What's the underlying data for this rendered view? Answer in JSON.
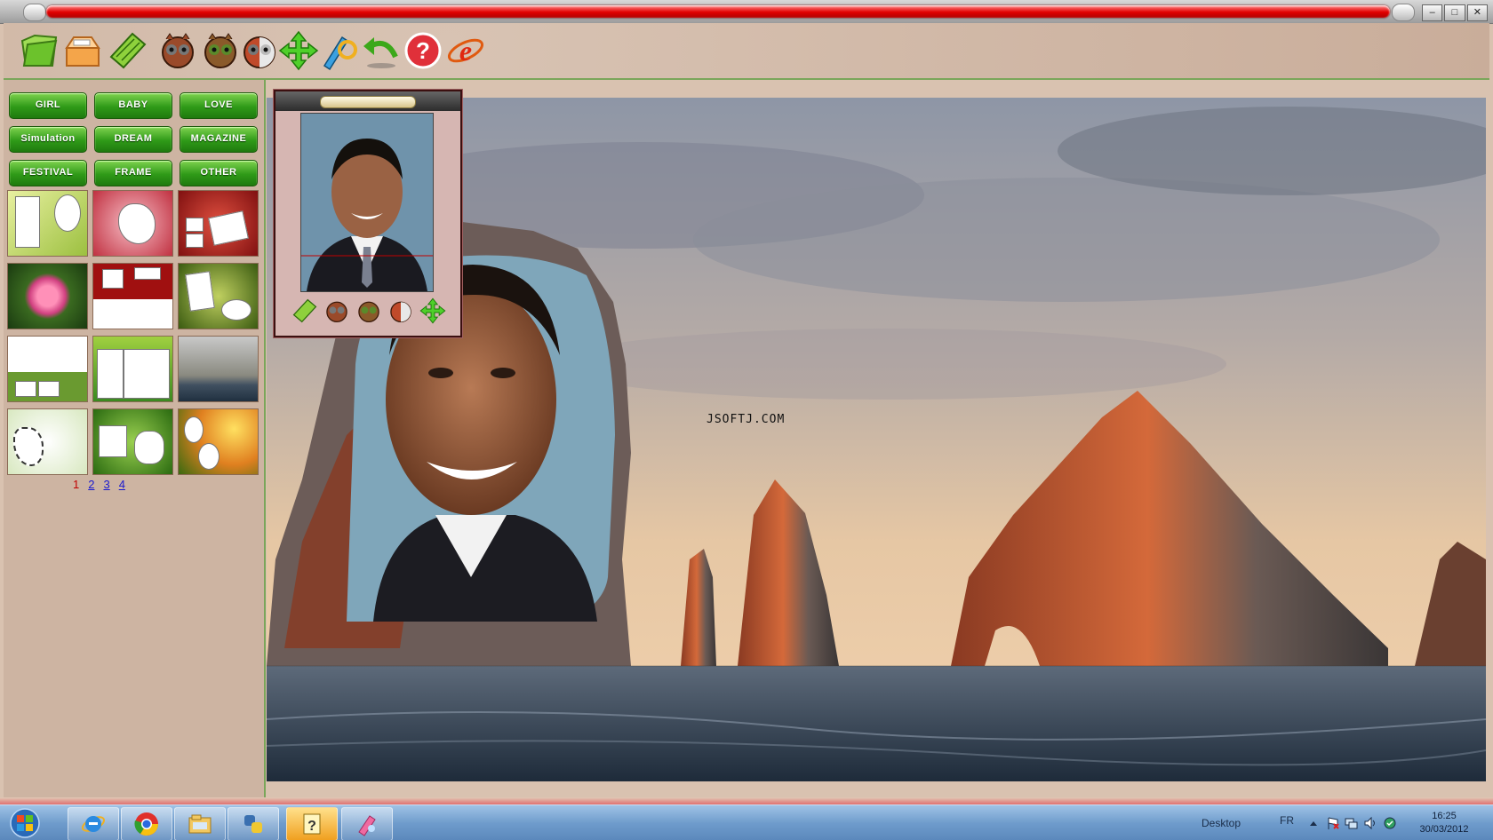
{
  "window": {
    "controls": [
      "‒",
      "□",
      "✕"
    ]
  },
  "toolbar": {
    "tools": [
      {
        "name": "open-folder-icon"
      },
      {
        "name": "open-box-icon"
      },
      {
        "name": "green-leaf-icon"
      },
      {
        "name": "owl-gray-icon"
      },
      {
        "name": "owl-brown-icon"
      },
      {
        "name": "owl-half-icon"
      },
      {
        "name": "move-arrows-icon"
      },
      {
        "name": "brush-pen-icon"
      },
      {
        "name": "undo-arrow-icon"
      },
      {
        "name": "help-icon",
        "glyph": "?"
      },
      {
        "name": "internet-explorer-icon",
        "glyph": "e"
      }
    ]
  },
  "categories": [
    "GIRL",
    "BABY",
    "LOVE",
    "Simulation",
    "DREAM",
    "MAGAZINE",
    "FESTIVAL",
    "FRAME",
    "OTHER"
  ],
  "pager": {
    "pages": [
      "1",
      "2",
      "3",
      "4"
    ],
    "current": "1"
  },
  "canvas": {
    "watermark": "JSOFTJ.COM"
  },
  "taskbar": {
    "desktop_label": "Desktop",
    "language": "FR",
    "time": "16:25",
    "date": "30/03/2012"
  },
  "colors": {
    "accent_green": "#2f9a18",
    "title_red": "#e10000",
    "panel_bg": "#cdb4a2"
  }
}
